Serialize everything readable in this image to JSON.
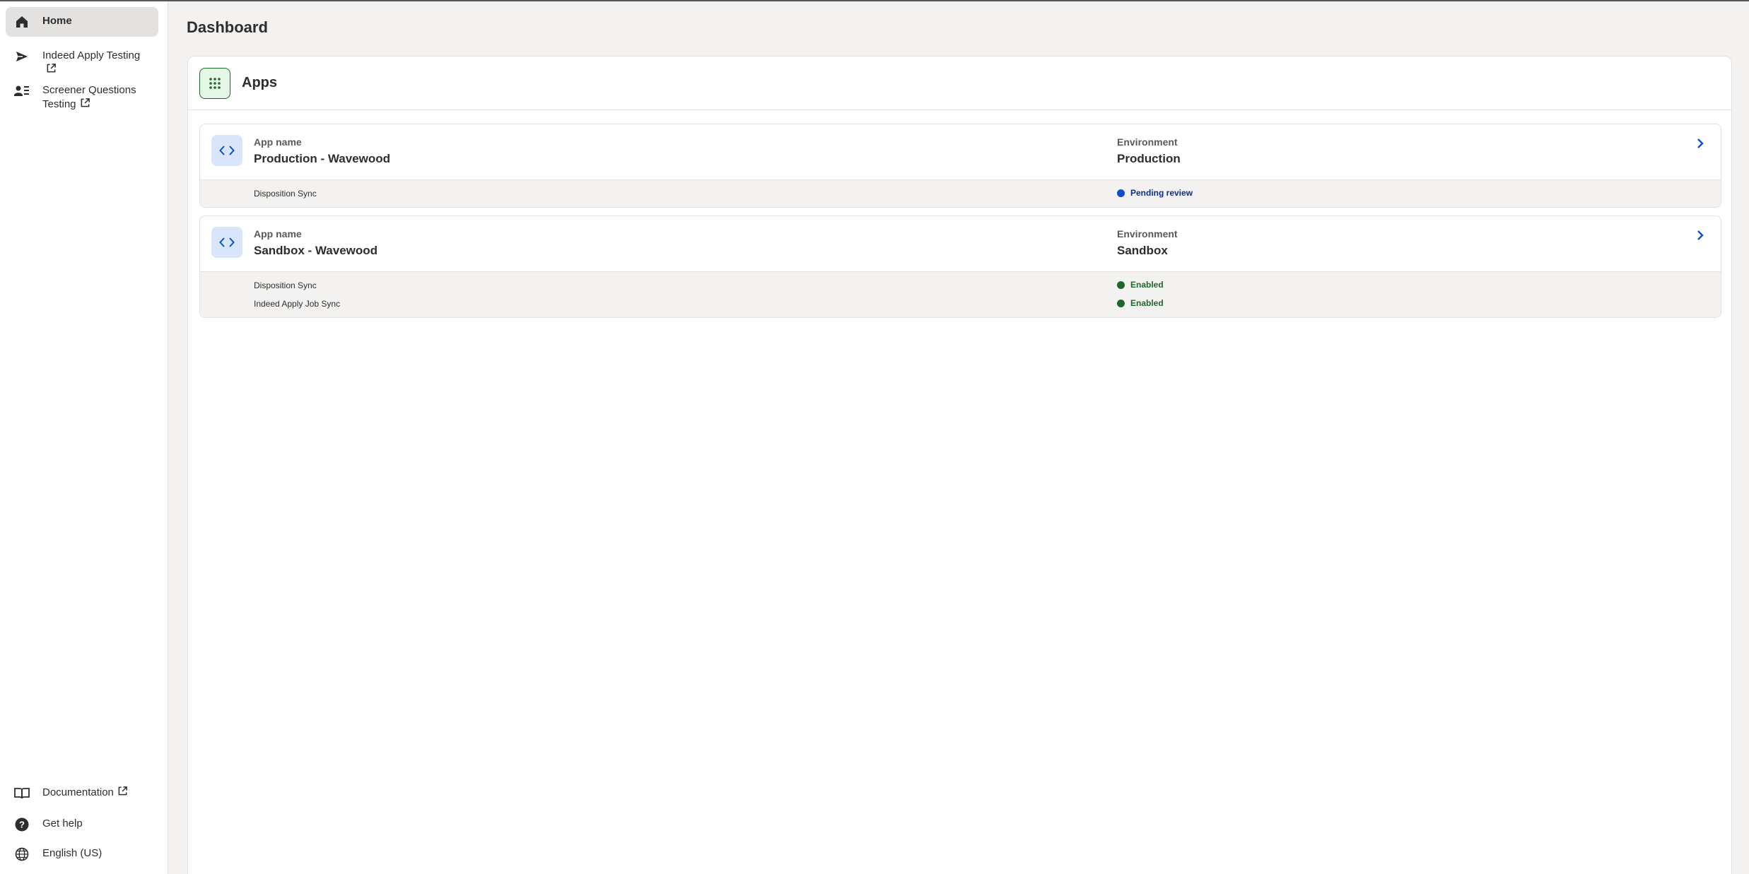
{
  "sidebar": {
    "items": [
      {
        "label": "Home",
        "icon": "home-icon"
      },
      {
        "label": "Indeed Apply Testing",
        "icon": "send-icon",
        "external": true
      },
      {
        "label_line1": "Screener Questions",
        "label_line2": "Testing",
        "icon": "person-list-icon",
        "external": true
      }
    ],
    "footer": [
      {
        "label": "Documentation",
        "icon": "book-icon",
        "external": true
      },
      {
        "label": "Get help",
        "icon": "help-icon"
      },
      {
        "label": "English (US)",
        "icon": "globe-icon"
      }
    ]
  },
  "main": {
    "title": "Dashboard",
    "panel_title": "Apps",
    "apps": [
      {
        "name_label": "App name",
        "name": "Production - Wavewood",
        "env_label": "Environment",
        "env": "Production",
        "features": [
          {
            "name": "Disposition Sync",
            "status": "Pending review",
            "status_color": "#0d4ecb"
          }
        ]
      },
      {
        "name_label": "App name",
        "name": "Sandbox - Wavewood",
        "env_label": "Environment",
        "env": "Sandbox",
        "features": [
          {
            "name": "Disposition Sync",
            "status": "Enabled",
            "status_color": "#1f662c"
          },
          {
            "name": "Indeed Apply Job Sync",
            "status": "Enabled",
            "status_color": "#1f662c"
          }
        ]
      }
    ]
  },
  "colors": {
    "accent_blue": "#0d4ecb",
    "enabled_green": "#1f662c",
    "background": "#f3f2f1"
  }
}
